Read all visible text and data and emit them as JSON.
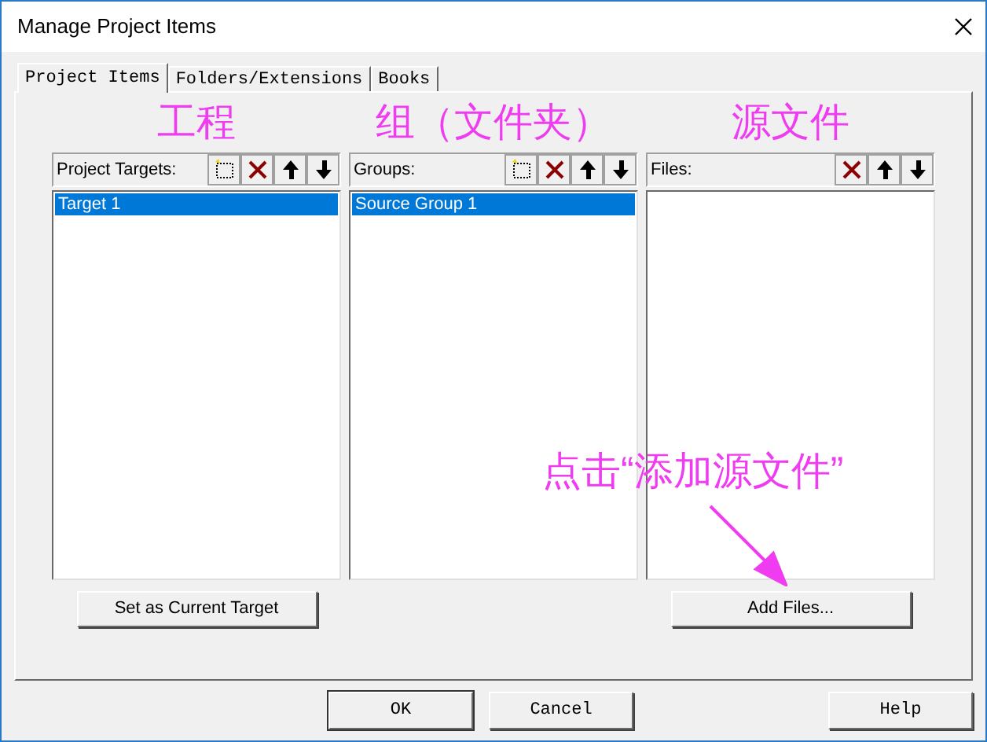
{
  "window": {
    "title": "Manage Project Items"
  },
  "tabs": [
    {
      "label": "Project Items",
      "selected": true
    },
    {
      "label": "Folders/Extensions",
      "selected": false
    },
    {
      "label": "Books",
      "selected": false
    }
  ],
  "columns": [
    {
      "annotation": "工程",
      "label": "Project Targets:",
      "tools": [
        {
          "kind": "new"
        },
        {
          "kind": "delete"
        },
        {
          "kind": "up"
        },
        {
          "kind": "down"
        }
      ],
      "items": [
        {
          "text": "Target 1",
          "selected": true
        }
      ],
      "button": "Set as Current Target"
    },
    {
      "annotation": "组（文件夹）",
      "label": "Groups:",
      "tools": [
        {
          "kind": "new"
        },
        {
          "kind": "delete"
        },
        {
          "kind": "up"
        },
        {
          "kind": "down"
        }
      ],
      "items": [
        {
          "text": "Source Group 1",
          "selected": true
        }
      ]
    },
    {
      "annotation": "源文件",
      "label": "Files:",
      "tools": [
        {
          "kind": "delete"
        },
        {
          "kind": "up"
        },
        {
          "kind": "down"
        }
      ],
      "button": "Add Files..."
    }
  ],
  "callout": {
    "text": "点击“添加源文件”"
  },
  "footer_buttons": [
    {
      "label": "OK",
      "default": true
    },
    {
      "label": "Cancel",
      "default": false
    },
    {
      "label": "Help",
      "default": false
    }
  ]
}
